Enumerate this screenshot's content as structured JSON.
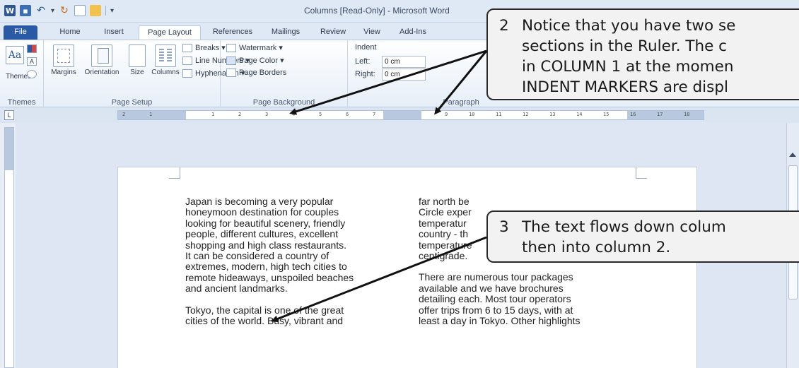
{
  "window": {
    "title": "Columns [Read-Only]  -  Microsoft Word"
  },
  "tabs": [
    "File",
    "Home",
    "Insert",
    "Page Layout",
    "References",
    "Mailings",
    "Review",
    "View",
    "Add-Ins"
  ],
  "ribbon": {
    "themes": {
      "button": "Themes",
      "group": "Themes"
    },
    "page_setup": {
      "margins": "Margins",
      "orientation": "Orientation",
      "size": "Size",
      "columns": "Columns",
      "breaks": "Breaks ▾",
      "line_numbers": "Line Numbers ▾",
      "hyphenation": "Hyphenation ▾",
      "group": "Page Setup"
    },
    "page_background": {
      "watermark": "Watermark ▾",
      "page_color": "Page Color ▾",
      "page_borders": "Page Borders",
      "group": "Page Background"
    },
    "paragraph": {
      "indent": "Indent",
      "left_label": "Left:",
      "left_value": "0 cm",
      "right_label": "Right:",
      "right_value": "0 cm",
      "group": "Paragraph"
    }
  },
  "ruler": {
    "ticks_col1": [
      "2",
      "1",
      "1",
      "2",
      "3",
      "4",
      "5",
      "6",
      "7"
    ],
    "ticks_col2": [
      "9",
      "10",
      "11",
      "12",
      "13",
      "14",
      "15",
      "16",
      "17",
      "18"
    ]
  },
  "document": {
    "col1": [
      [
        "Japan is becoming a very popular",
        "honeymoon destination for couples",
        "looking for beautiful scenery, friendly",
        "people, different cultures, excellent",
        "shopping and high class restaurants.",
        "It can be considered a country of",
        "extremes, modern, high tech cities to",
        "remote hideaways, unspoiled beaches",
        "and ancient landmarks."
      ],
      [
        "Tokyo, the capital is one of the great",
        "cities of the world.  Busy, vibrant and"
      ]
    ],
    "col2": [
      [
        "far north be",
        "Circle exper",
        "temperatur",
        "country - th",
        "temperature",
        "centigrade."
      ],
      [
        "There are numerous tour packages",
        "available and we have brochures",
        "detailing each.  Most tour operators",
        "offer trips from 6 to 15 days, with at",
        "least a day in Tokyo.  Other highlights"
      ]
    ]
  },
  "callouts": [
    {
      "number": "2",
      "lines": [
        "Notice that you have two se",
        "sections in the Ruler.  The c",
        "in COLUMN 1 at the momen",
        "INDENT MARKERS are displ"
      ]
    },
    {
      "number": "3",
      "lines": [
        "The text flows down colum",
        "then into column 2."
      ]
    }
  ]
}
